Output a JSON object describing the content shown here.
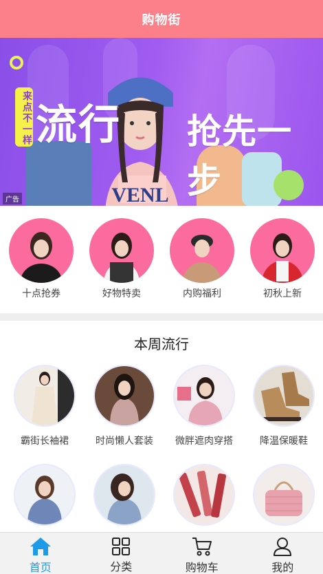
{
  "header": {
    "title": "购物街"
  },
  "banner": {
    "tag": "来点不一样",
    "slogan_left": "流行",
    "slogan_right": "抢先一步",
    "ad_label": "广告"
  },
  "categories": [
    {
      "label": "十点抢券"
    },
    {
      "label": "好物特卖"
    },
    {
      "label": "内购福利"
    },
    {
      "label": "初秋上新"
    }
  ],
  "trend": {
    "heading": "本周流行",
    "items": [
      {
        "label": "霸街长袖裙"
      },
      {
        "label": "时尚懒人套装"
      },
      {
        "label": "微胖遮肉穿搭"
      },
      {
        "label": "降温保暖鞋"
      }
    ]
  },
  "tabbar": {
    "tabs": [
      {
        "label": "首页",
        "icon": "home-icon",
        "active": true
      },
      {
        "label": "分类",
        "icon": "grid-icon",
        "active": false
      },
      {
        "label": "购物车",
        "icon": "cart-icon",
        "active": false
      },
      {
        "label": "我的",
        "icon": "user-icon",
        "active": false
      }
    ]
  },
  "colors": {
    "header_bg": "#fb8089",
    "category_circle": "#fb6b9e",
    "active_tab": "#1e9be8",
    "banner_bg": "#9a55ee"
  }
}
